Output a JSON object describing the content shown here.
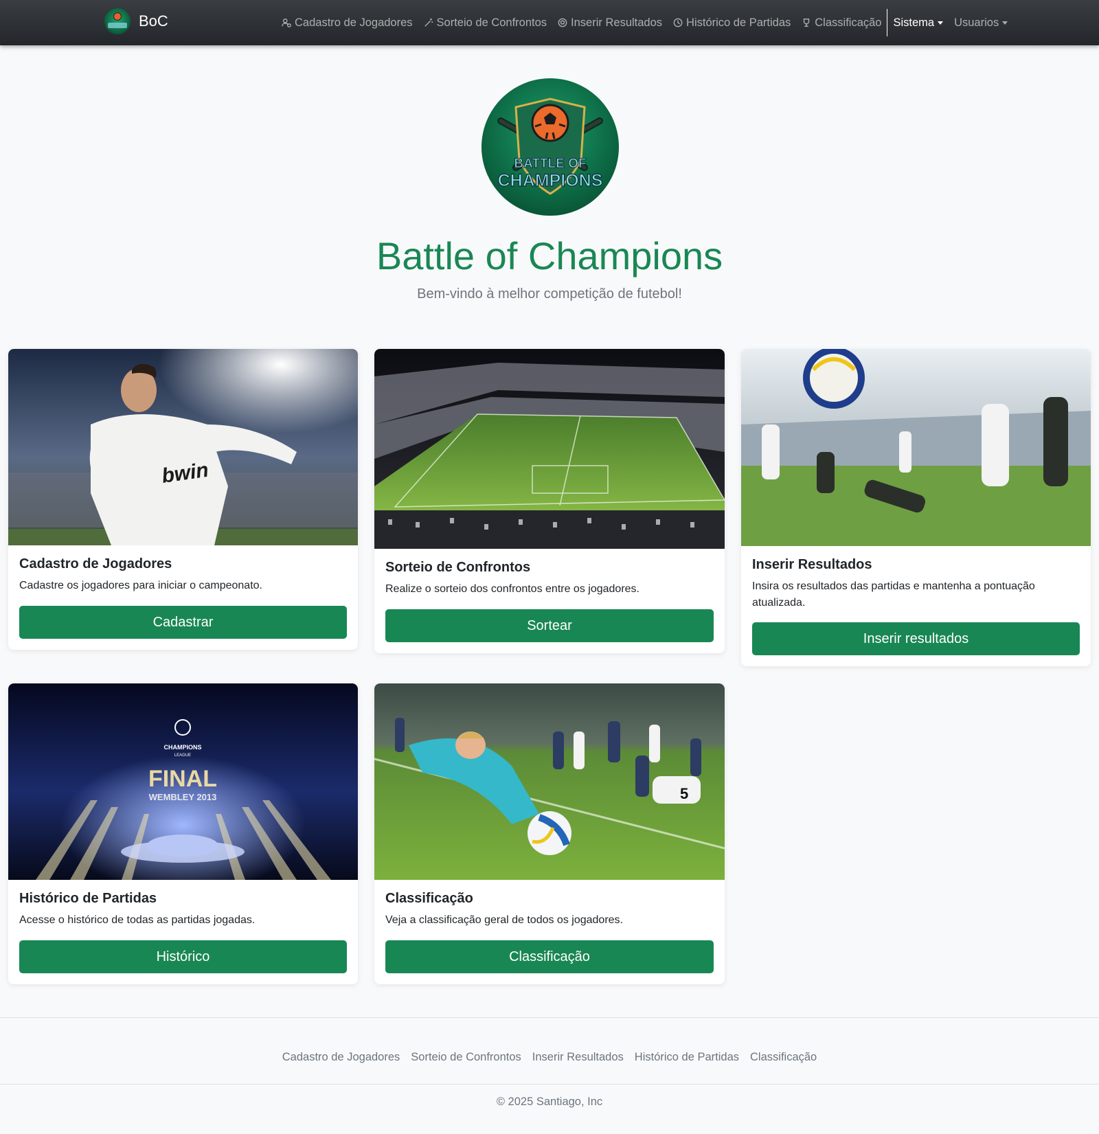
{
  "navbar": {
    "brand": "BoC",
    "items": [
      {
        "label": "Cadastro de Jogadores"
      },
      {
        "label": "Sorteio de Confrontos"
      },
      {
        "label": "Inserir Resultados"
      },
      {
        "label": "Histórico de Partidas"
      },
      {
        "label": "Classificação"
      }
    ],
    "dropdowns": [
      {
        "label": "Sistema"
      },
      {
        "label": "Usuarios"
      }
    ]
  },
  "hero": {
    "logo_text_1": "BATTLE OF",
    "logo_text_2": "CHAMPIONS",
    "title": "Battle of Champions",
    "subtitle": "Bem-vindo à melhor competição de futebol!"
  },
  "cards": [
    {
      "title": "Cadastro de Jogadores",
      "text": "Cadastre os jogadores para iniciar o campeonato.",
      "button": "Cadastrar",
      "img_text": "bwin"
    },
    {
      "title": "Sorteio de Confrontos",
      "text": "Realize o sorteio dos confrontos entre os jogadores.",
      "button": "Sortear"
    },
    {
      "title": "Inserir Resultados",
      "text": "Insira os resultados das partidas e mantenha a pontuação atualizada.",
      "button": "Inserir resultados"
    },
    {
      "title": "Histórico de Partidas",
      "text": "Acesse o histórico de todas as partidas jogadas.",
      "button": "Histórico",
      "img_text_1": "CHAMPIONS",
      "img_text_2": "LEAGUE",
      "img_text_3": "FINAL",
      "img_text_4": "WEMBLEY 2013"
    },
    {
      "title": "Classificação",
      "text": "Veja a classificação geral de todos os jogadores.",
      "button": "Classificação",
      "img_text": "5"
    }
  ],
  "footer": {
    "links": [
      {
        "label": "Cadastro de Jogadores"
      },
      {
        "label": "Sorteio de Confrontos"
      },
      {
        "label": "Inserir Resultados"
      },
      {
        "label": "Histórico de Partidas"
      },
      {
        "label": "Classificação"
      }
    ],
    "copyright": "© 2025 Santiago, Inc"
  },
  "colors": {
    "primary": "#198754",
    "navbar": "#2b2f33",
    "background": "#f8f9fa"
  }
}
